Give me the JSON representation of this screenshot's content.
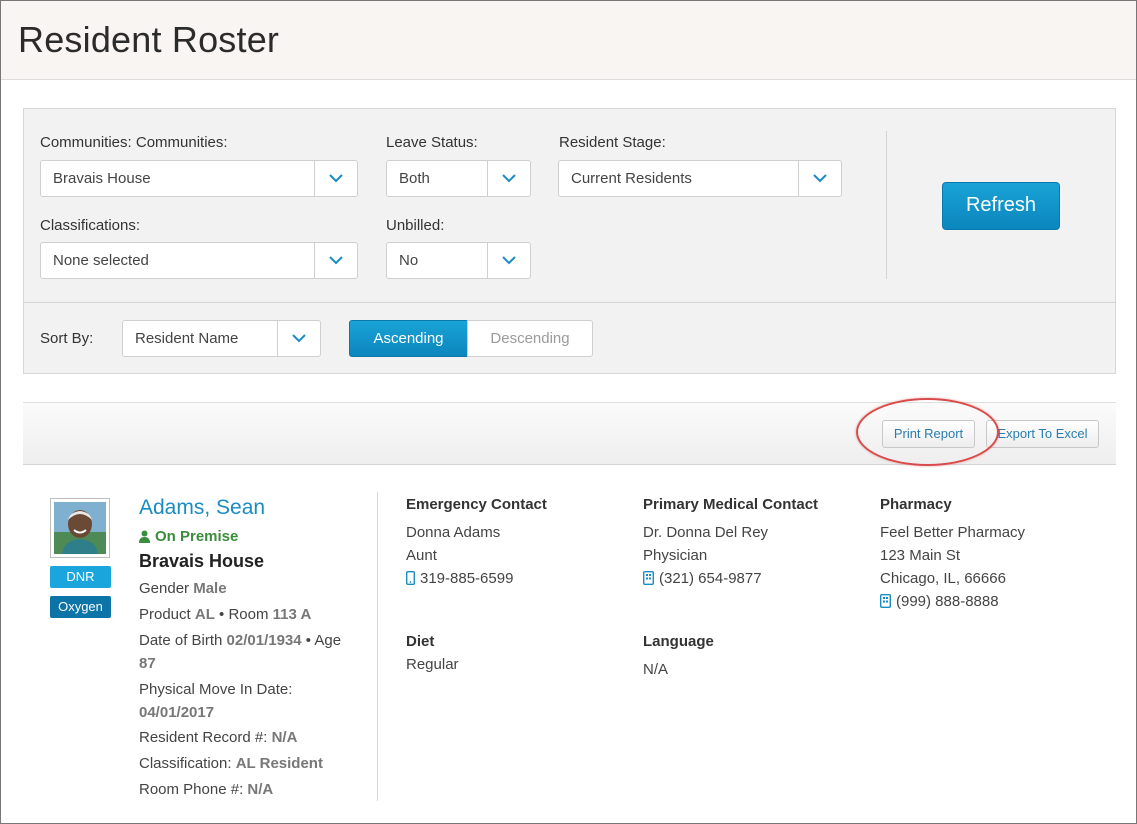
{
  "page": {
    "title": "Resident Roster"
  },
  "filters": {
    "communities": {
      "label": "Communities: Communities:",
      "value": "Bravais House"
    },
    "leave_status": {
      "label": "Leave Status:",
      "value": "Both"
    },
    "resident_stage": {
      "label": "Resident Stage:",
      "value": "Current Residents"
    },
    "classifications": {
      "label": "Classifications:",
      "value": "None selected"
    },
    "unbilled": {
      "label": "Unbilled:",
      "value": "No"
    },
    "refresh_label": "Refresh",
    "sort_by": {
      "label": "Sort By:",
      "value": "Resident Name"
    },
    "ascending_label": "Ascending",
    "descending_label": "Descending",
    "selected_order": "Ascending"
  },
  "toolbar": {
    "print_label": "Print Report",
    "export_label": "Export To Excel"
  },
  "resident": {
    "name": "Adams, Sean",
    "status": "On Premise",
    "community": "Bravais House",
    "tags": [
      "DNR",
      "Oxygen"
    ],
    "gender_label": "Gender",
    "gender": "Male",
    "product_label": "Product",
    "product": "AL",
    "room_label": "• Room",
    "room": "113 A",
    "dob_label": "Date of Birth",
    "dob": "02/01/1934",
    "age_label": "• Age",
    "age": "87",
    "move_in_label": "Physical Move In Date:",
    "move_in": "04/01/2017",
    "record_label": "Resident Record #:",
    "record": "N/A",
    "classification_label": "Classification:",
    "classification": "AL Resident",
    "room_phone_label": "Room Phone #:",
    "room_phone": "N/A"
  },
  "emergency_contact": {
    "heading": "Emergency Contact",
    "name": "Donna Adams",
    "relation": "Aunt",
    "phone": "319-885-6599"
  },
  "medical_contact": {
    "heading": "Primary Medical Contact",
    "name": "Dr. Donna Del Rey",
    "role": "Physician",
    "phone": "(321) 654-9877"
  },
  "pharmacy": {
    "heading": "Pharmacy",
    "name": "Feel Better Pharmacy",
    "address1": "123 Main St",
    "address2": "Chicago, IL, 66666",
    "phone": "(999) 888-8888"
  },
  "diet": {
    "heading": "Diet",
    "value": "Regular"
  },
  "language": {
    "heading": "Language",
    "value": "N/A"
  },
  "colors": {
    "accent": "#0a86bd",
    "link": "#1a8cc4",
    "status_green": "#3a8d3a",
    "dnr_tag": "#1aa6dc",
    "oxygen_tag": "#0d74a8",
    "annotation_circle": "#d94b4b"
  }
}
